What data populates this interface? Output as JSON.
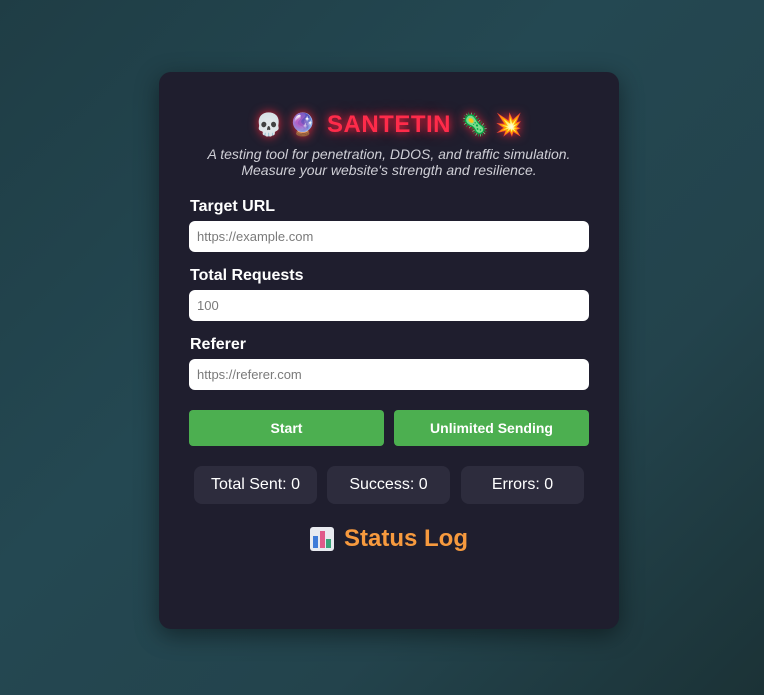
{
  "header": {
    "title": "SANTETIN",
    "left_icons": [
      "skull-icon",
      "crystal-ball-icon"
    ],
    "right_icons": [
      "microbe-icon",
      "collision-icon"
    ],
    "subtitle_line1": "A testing tool for penetration, DDOS, and traffic simulation.",
    "subtitle_line2": "Measure your website's strength and resilience."
  },
  "form": {
    "target_url": {
      "label": "Target URL",
      "placeholder": "https://example.com",
      "value": ""
    },
    "total_requests": {
      "label": "Total Requests",
      "placeholder": "100",
      "value": ""
    },
    "referer": {
      "label": "Referer",
      "placeholder": "https://referer.com",
      "value": ""
    }
  },
  "buttons": {
    "start_label": "Start",
    "unlimited_label": "Unlimited Sending"
  },
  "stats": {
    "total_sent": "Total Sent: 0",
    "success": "Success: 0",
    "errors": "Errors: 0"
  },
  "log": {
    "icon": "bar-chart-icon",
    "title": "Status Log"
  },
  "colors": {
    "accent_red": "#ff2b4a",
    "button_green": "#4caf50",
    "log_orange": "#f79a3e",
    "card_bg": "#1f1e2e"
  }
}
